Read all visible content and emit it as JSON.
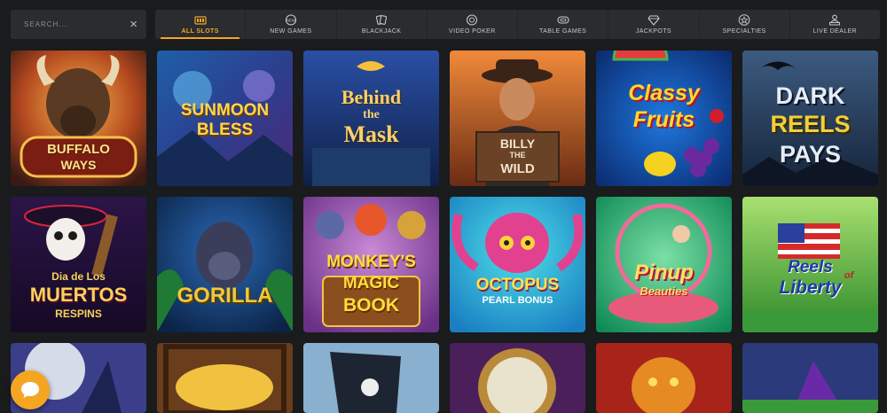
{
  "search": {
    "placeholder": "SEARCH..."
  },
  "tabs": [
    {
      "label": "ALL SLOTS",
      "icon": "slot-machine-icon",
      "active": true
    },
    {
      "label": "NEW GAMES",
      "icon": "new-badge-icon",
      "active": false
    },
    {
      "label": "BLACKJACK",
      "icon": "playing-cards-icon",
      "active": false
    },
    {
      "label": "VIDEO POKER",
      "icon": "poker-chip-icon",
      "active": false
    },
    {
      "label": "TABLE GAMES",
      "icon": "table-icon",
      "active": false
    },
    {
      "label": "JACKPOTS",
      "icon": "diamond-icon",
      "active": false
    },
    {
      "label": "SPECIALTIES",
      "icon": "star-icon",
      "active": false
    },
    {
      "label": "LIVE DEALER",
      "icon": "dealer-icon",
      "active": false
    }
  ],
  "games": [
    {
      "title": "BUFFALO WAYS",
      "line1": "BUFFALO",
      "line2": "WAYS",
      "line3": ""
    },
    {
      "title": "SUNMOON BLESS",
      "line1": "SUNMOON",
      "line2": "BLESS",
      "line3": ""
    },
    {
      "title": "Behind the Mask",
      "line1": "Behind",
      "line2": "the",
      "line3": "Mask"
    },
    {
      "title": "BILLY THE WILD",
      "line1": "BILLY",
      "line2": "THE",
      "line3": "WILD"
    },
    {
      "title": "Classy Fruits",
      "line1": "Classy",
      "line2": "Fruits",
      "line3": ""
    },
    {
      "title": "DARK REELS PAYS",
      "line1": "DARK",
      "line2": "REELS",
      "line3": "PAYS"
    },
    {
      "title": "Dia de Los Muertos Respins",
      "line1": "Dia de Los",
      "line2": "MUERTOS",
      "line3": "RESPINS"
    },
    {
      "title": "GORILLA",
      "line1": "GORILLA",
      "line2": "",
      "line3": ""
    },
    {
      "title": "MONKEY'S MAGIC BOOK",
      "line1": "MONKEY'S",
      "line2": "MAGIC",
      "line3": "BOOK"
    },
    {
      "title": "OCTOPUS PEARL BONUS",
      "line1": "OCTOPUS",
      "line2": "PEARL",
      "line3": "BONUS"
    },
    {
      "title": "Pinup Beauties",
      "line1": "Pinup",
      "line2": "Beauties",
      "line3": ""
    },
    {
      "title": "Reels of Liberty",
      "line1": "Reels",
      "line2": "of",
      "line3": "Liberty"
    },
    {
      "title": "",
      "line1": "",
      "line2": "",
      "line3": ""
    },
    {
      "title": "",
      "line1": "",
      "line2": "",
      "line3": ""
    },
    {
      "title": "",
      "line1": "",
      "line2": "",
      "line3": ""
    },
    {
      "title": "",
      "line1": "",
      "line2": "",
      "line3": ""
    },
    {
      "title": "",
      "line1": "",
      "line2": "",
      "line3": ""
    },
    {
      "title": "",
      "line1": "",
      "line2": "",
      "line3": ""
    }
  ],
  "theme": {
    "accent": "#f4a623",
    "background": "#1a1b1d",
    "bar": "#2b2c30"
  },
  "chat": {
    "icon": "chat-bubble-icon"
  }
}
